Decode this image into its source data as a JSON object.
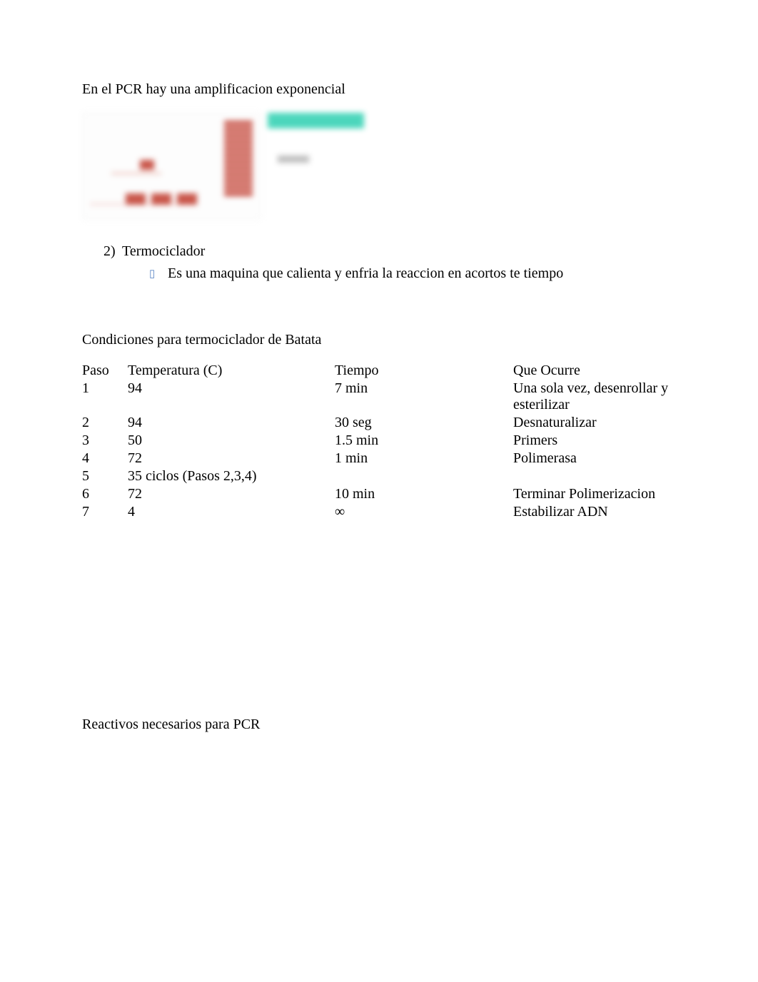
{
  "intro_line": "En el PCR hay una amplificacion exponencial",
  "list_item_2": {
    "number": "2)",
    "label": "Termociclador"
  },
  "bullet_1": {
    "glyph": "▯",
    "text": "Es una maquina que calienta y enfria la reaccion en acortos te tiempo"
  },
  "conditions_title": "Condiciones para termociclador de Batata",
  "table": {
    "headers": {
      "paso": "Paso",
      "temp": "Temperatura (C)",
      "tiempo": "Tiempo",
      "que": "Que Ocurre"
    },
    "rows": [
      {
        "paso": "1",
        "temp": "94",
        "tiempo": "7 min",
        "que": "Una sola vez, desenrollar y esterilizar"
      },
      {
        "paso": "2",
        "temp": "94",
        "tiempo": "30 seg",
        "que": "Desnaturalizar"
      },
      {
        "paso": "3",
        "temp": "50",
        "tiempo": "1.5 min",
        "que": "Primers"
      },
      {
        "paso": "4",
        "temp": "72",
        "tiempo": "1 min",
        "que": "Polimerasa"
      },
      {
        "paso": "5",
        "temp": "35 ciclos (Pasos 2,3,4)",
        "tiempo": "",
        "que": ""
      },
      {
        "paso": "6",
        "temp": "72",
        "tiempo": "10 min",
        "que": "Terminar Polimerizacion"
      },
      {
        "paso": "7",
        "temp": "4",
        "tiempo": "∞",
        "que": "Estabilizar ADN"
      }
    ]
  },
  "reagents_title": "Reactivos necesarios para PCR"
}
